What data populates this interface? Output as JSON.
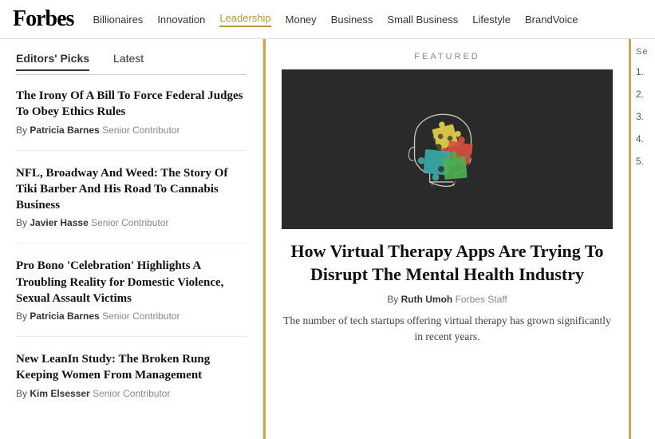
{
  "header": {
    "logo": "Forbes",
    "nav": [
      {
        "label": "Billionaires",
        "active": false
      },
      {
        "label": "Innovation",
        "active": false
      },
      {
        "label": "Leadership",
        "active": true
      },
      {
        "label": "Money",
        "active": false
      },
      {
        "label": "Business",
        "active": false
      },
      {
        "label": "Small Business",
        "active": false
      },
      {
        "label": "Lifestyle",
        "active": false
      },
      {
        "label": "BrandVoice",
        "active": false
      }
    ]
  },
  "sidebar": {
    "tabs": [
      {
        "label": "Editors' Picks",
        "active": true
      },
      {
        "label": "Latest",
        "active": false
      }
    ],
    "articles": [
      {
        "title": "The Irony Of A Bill To Force Federal Judges To Obey Ethics Rules",
        "author": "Patricia Barnes",
        "role": "Senior Contributor"
      },
      {
        "title": "NFL, Broadway And Weed: The Story Of Tiki Barber And His Road To Cannabis Business",
        "author": "Javier Hasse",
        "role": "Senior Contributor"
      },
      {
        "title": "Pro Bono 'Celebration' Highlights A Troubling Reality for Domestic Violence, Sexual Assault Victims",
        "author": "Patricia Barnes",
        "role": "Senior Contributor"
      },
      {
        "title": "New LeanIn Study: The Broken Rung Keeping Women From Management",
        "author": "Kim Elsesser",
        "role": "Senior Contributor"
      }
    ]
  },
  "featured": {
    "label": "FEATURED",
    "title": "How Virtual Therapy Apps Are Trying To Disrupt The Mental Health Industry",
    "author": "Ruth Umoh",
    "role": "Forbes Staff",
    "description": "The number of tech startups offering virtual therapy has grown significantly in recent years."
  },
  "right_panel": {
    "title": "Se",
    "items": [
      "1.",
      "2.",
      "3.",
      "4.",
      "5."
    ]
  }
}
